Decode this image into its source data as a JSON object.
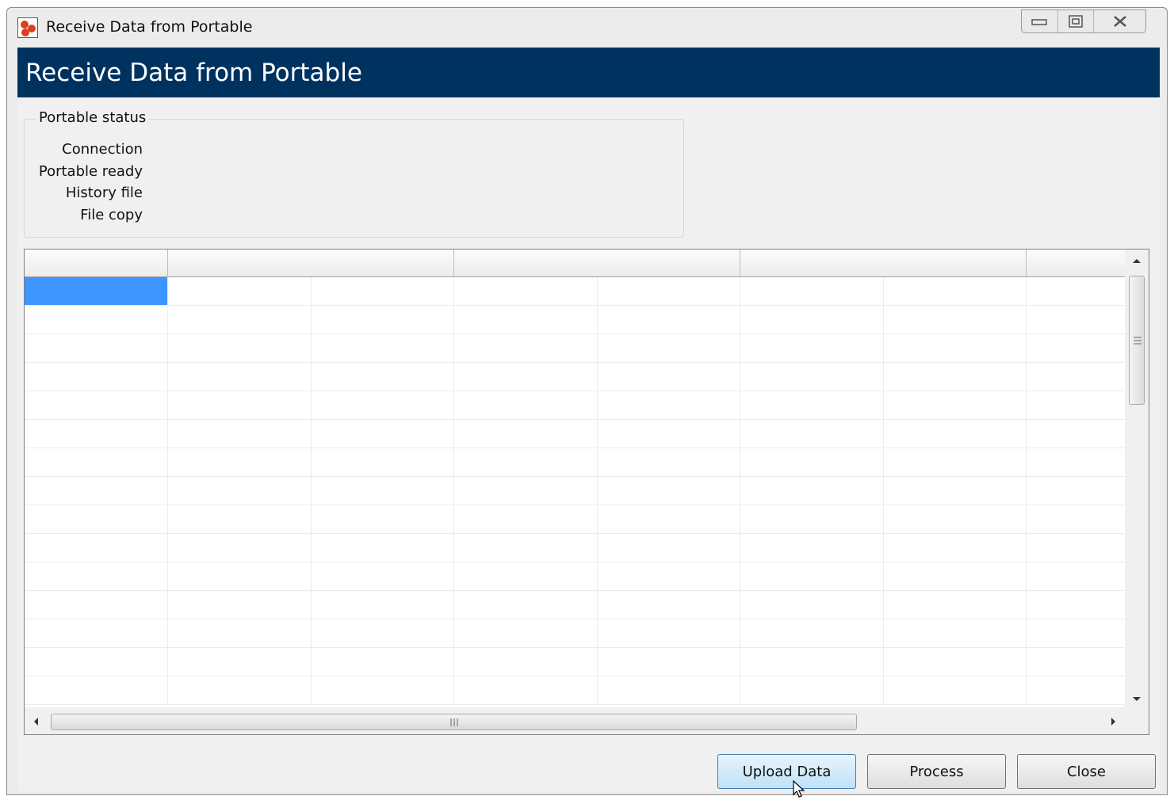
{
  "window": {
    "title": "Receive Data from Portable",
    "header_title": "Receive Data from Portable"
  },
  "status": {
    "group_title": "Portable status",
    "labels": [
      "Connection",
      "Portable ready",
      "History file",
      "File copy"
    ]
  },
  "grid": {
    "columns": [
      "",
      "",
      "",
      "",
      "",
      "",
      "",
      ""
    ],
    "selected_cell": {
      "row": 0,
      "col": 0
    },
    "row_count": 15
  },
  "buttons": {
    "upload": "Upload Data",
    "process": "Process",
    "close": "Close"
  },
  "colors": {
    "header_band": "#003260",
    "selection": "#3d95ff"
  }
}
